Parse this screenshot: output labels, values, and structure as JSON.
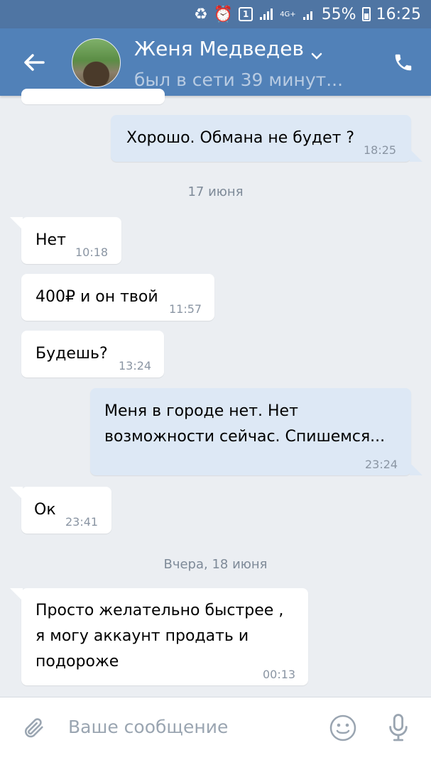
{
  "status_bar": {
    "sim_badge": "1",
    "network": "4G+",
    "battery": "55%",
    "time": "16:25"
  },
  "header": {
    "contact_name": "Женя Медведев",
    "last_seen": "был в сети 39 минут...",
    "icons": [
      "back-arrow-icon",
      "chevron-down-icon",
      "phone-icon"
    ]
  },
  "messages": [
    {
      "direction": "out",
      "text": "Хорошо. Обмана не будет ?",
      "time": "18:25"
    },
    {
      "type": "date",
      "text": "17 июня"
    },
    {
      "direction": "in",
      "text": "Нет",
      "time": "10:18"
    },
    {
      "direction": "in",
      "text": "400₽ и он твой",
      "time": "11:57"
    },
    {
      "direction": "in",
      "text": "Будешь?",
      "time": "13:24"
    },
    {
      "direction": "out",
      "text": "Меня в городе нет. Нет\nвозможности сейчас. Спишемся...",
      "time": "23:24"
    },
    {
      "direction": "in",
      "text": "Ок",
      "time": "23:41"
    },
    {
      "type": "date",
      "text": "Вчера, 18 июня"
    },
    {
      "direction": "in",
      "text": "Просто желательно быстрее ,\nя могу аккаунт продать и\nподороже",
      "time": "00:13"
    }
  ],
  "input": {
    "placeholder": "Ваше сообщение",
    "icons": [
      "attach-icon",
      "emoji-icon",
      "microphone-icon"
    ]
  },
  "colors": {
    "header": "#5181b8",
    "statusbar": "#4f75a3",
    "background": "#ebeef2",
    "outgoing_bubble": "#dde8f5",
    "incoming_bubble": "#ffffff"
  }
}
